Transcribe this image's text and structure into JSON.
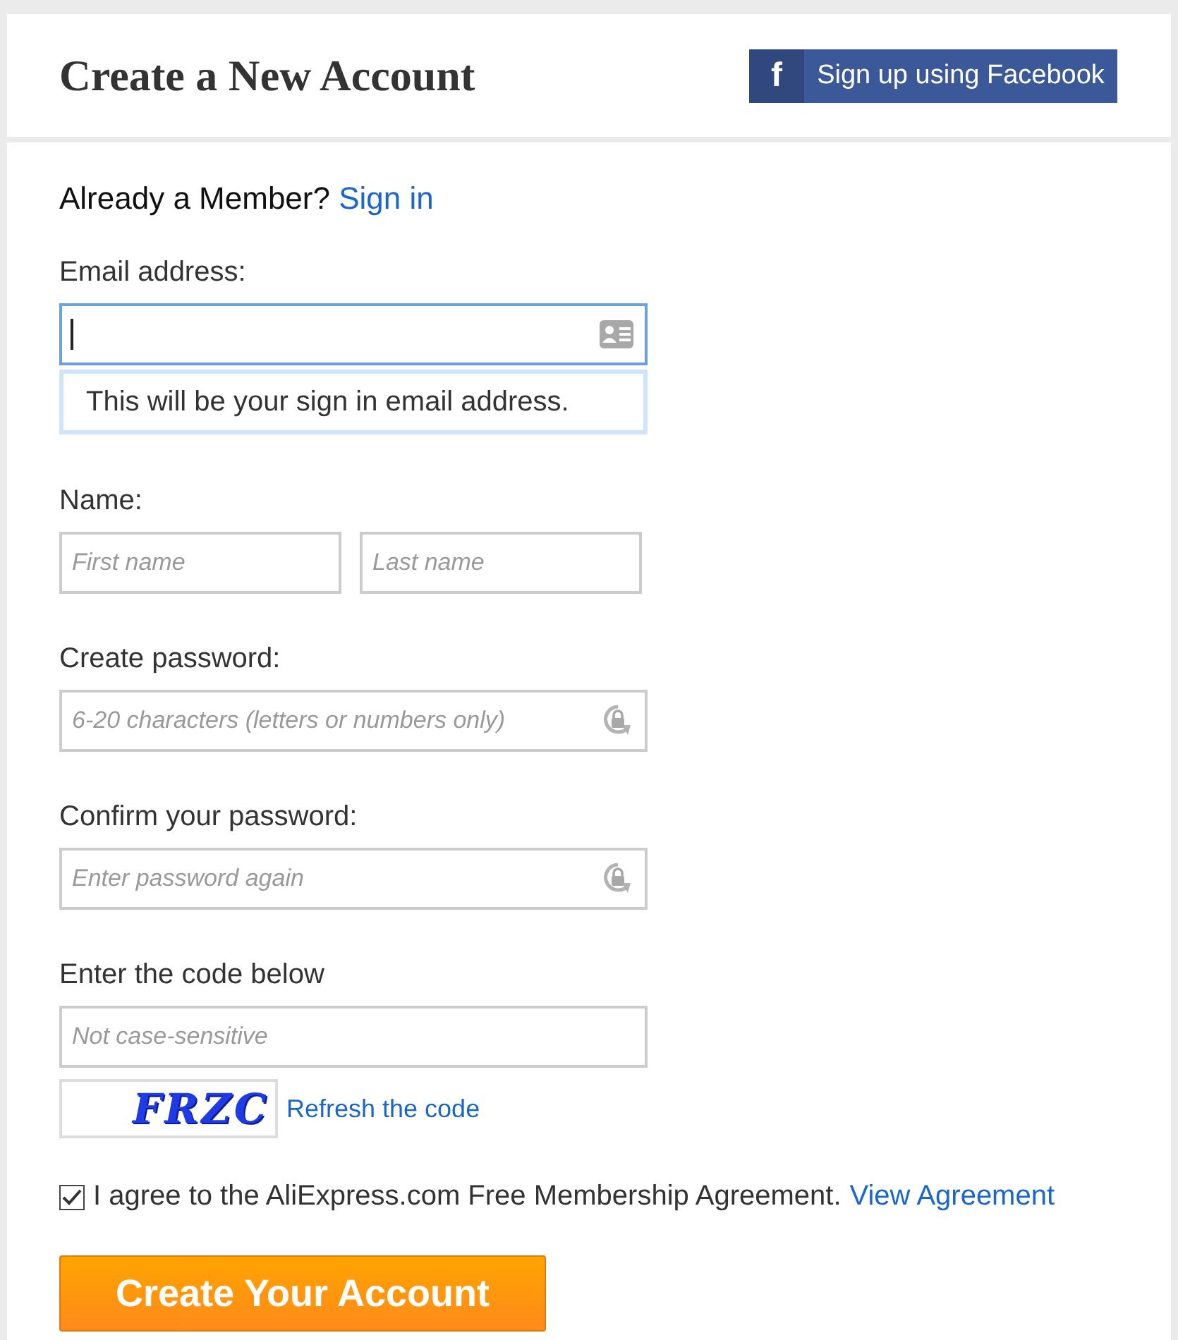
{
  "header": {
    "title": "Create a New Account",
    "facebook_button": {
      "icon": "f",
      "label": "Sign up using Facebook"
    }
  },
  "member_prompt": {
    "text": "Already a Member?",
    "link": "Sign in"
  },
  "email": {
    "label": "Email address:",
    "focused": true,
    "hint": "This will be your sign in email address."
  },
  "name": {
    "label": "Name:",
    "fields": [
      {
        "placeholder": "First name"
      },
      {
        "placeholder": "Last name"
      }
    ]
  },
  "password": {
    "label": "Create password:",
    "placeholder": "6-20 characters (letters or numbers only)"
  },
  "confirm_password": {
    "label": "Confirm your password:",
    "placeholder": "Enter password again"
  },
  "code": {
    "label": "Enter the code below",
    "placeholder": "Not case-sensitive",
    "captcha": "FRZC",
    "refresh_link": "Refresh the code"
  },
  "agreement": {
    "checked": true,
    "text": "I agree to the AliExpress.com Free Membership Agreement.",
    "link": "View Agreement"
  },
  "submit_button": "Create Your Account"
}
